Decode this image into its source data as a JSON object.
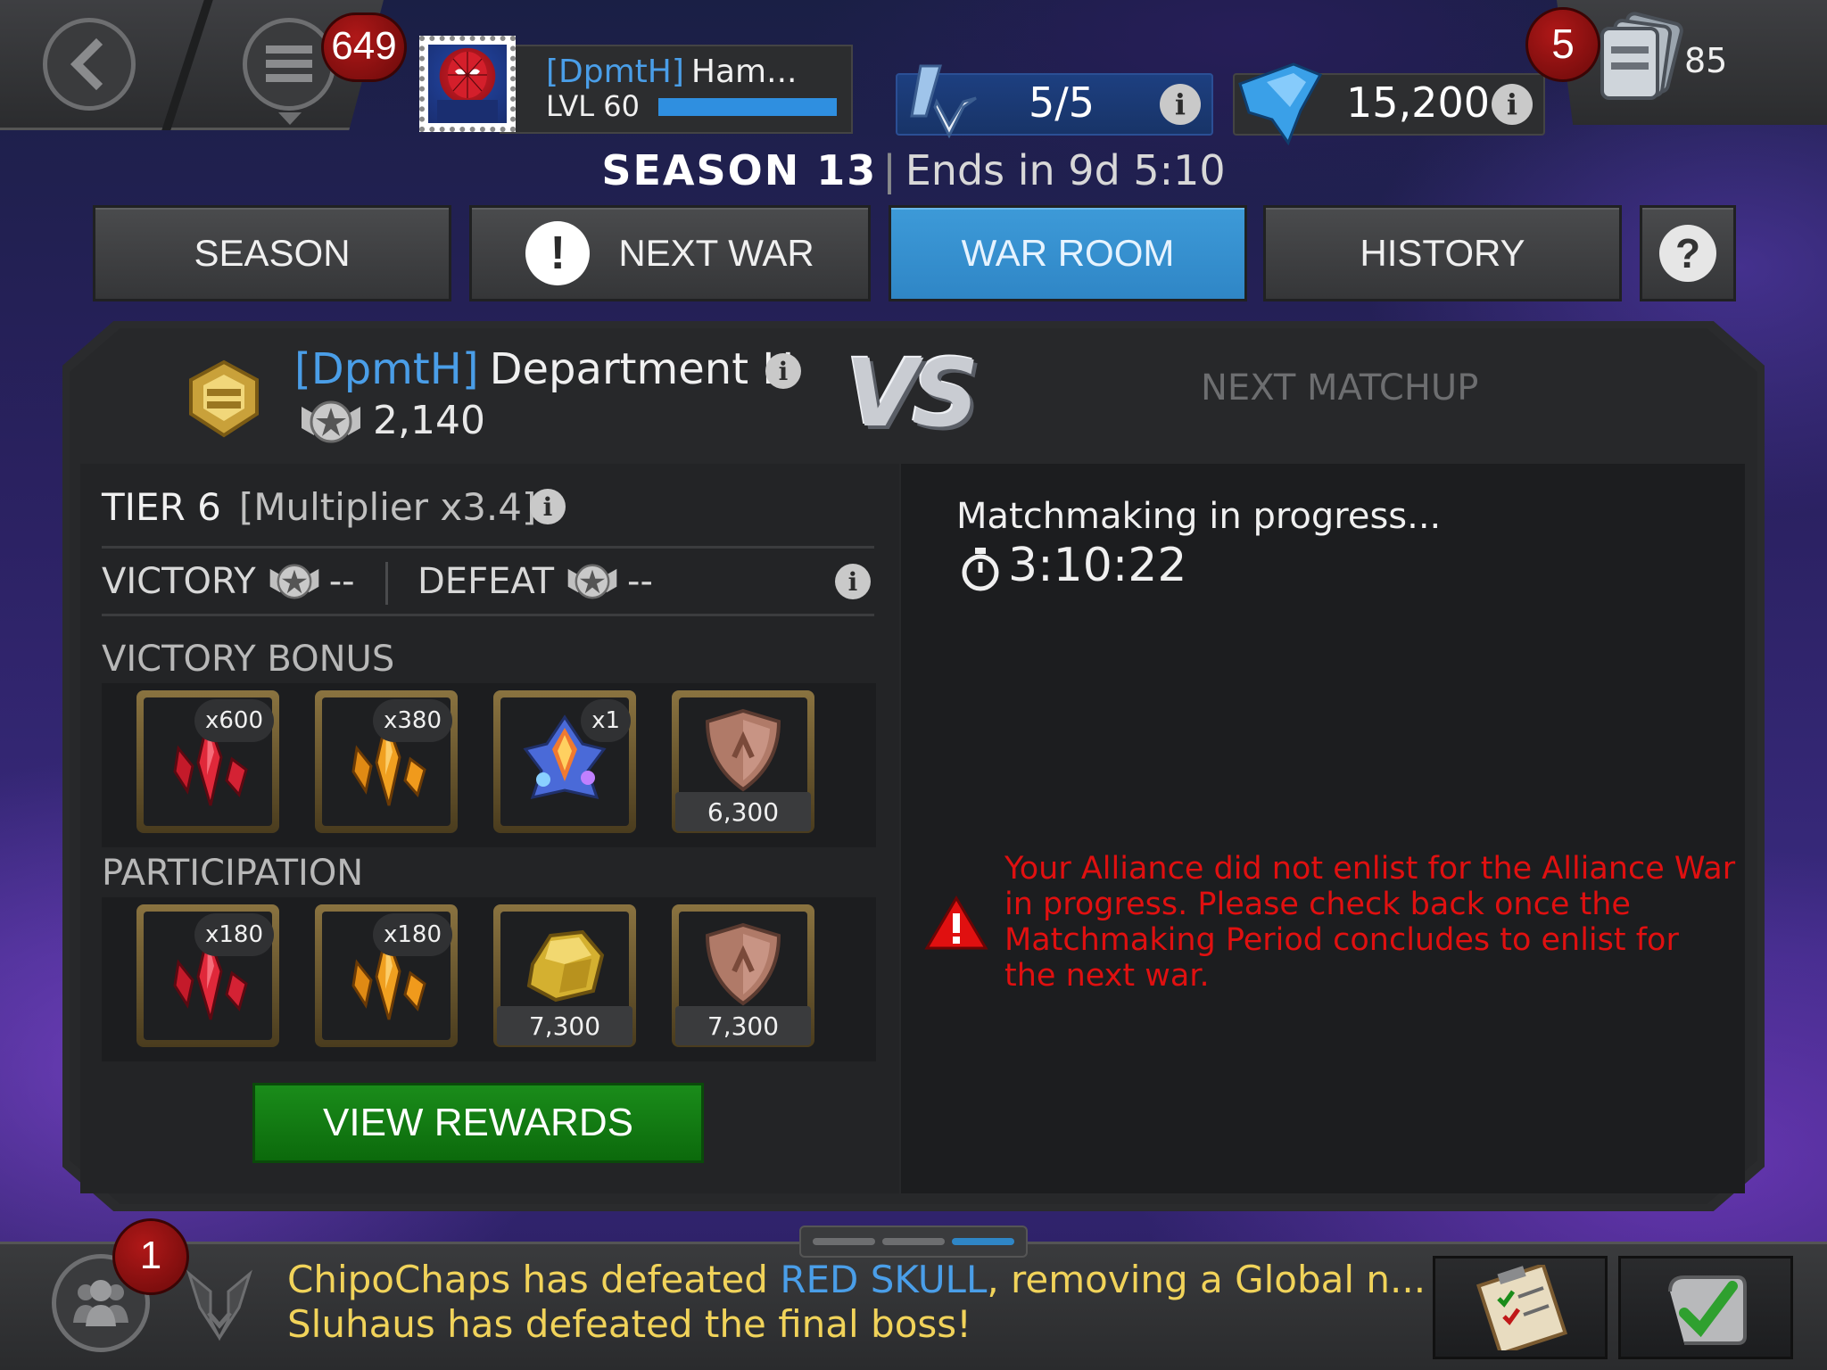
{
  "header": {
    "menu_badge": "649",
    "profile": {
      "alliance_tag": "[DpmtH]",
      "name": "Ham...",
      "level": "LVL 60",
      "xp_progress": 1.0
    },
    "energy": {
      "value": "5/5"
    },
    "crystals": {
      "value": "15,200"
    },
    "mail": {
      "badge": "5",
      "count": "85"
    }
  },
  "season": {
    "title": "SEASON 13",
    "separator": "|",
    "ends": "Ends in 9d 5:10"
  },
  "tabs": [
    {
      "label": "SEASON",
      "active": false
    },
    {
      "label": "NEXT WAR",
      "active": false,
      "alert_glyph": "!"
    },
    {
      "label": "WAR ROOM",
      "active": true
    },
    {
      "label": "HISTORY",
      "active": false
    }
  ],
  "help_glyph": "?",
  "alliance": {
    "tag": "[DpmtH]",
    "name": "Department H",
    "rating": "2,140",
    "vs_text": "VS",
    "opponent": "NEXT MATCHUP"
  },
  "tier": {
    "label": "TIER 6",
    "multiplier": "[Multiplier x3.4]",
    "victory_label": "VICTORY",
    "victory_value": "--",
    "defeat_label": "DEFEAT",
    "defeat_value": "--"
  },
  "victory_bonus": {
    "heading": "VICTORY BONUS",
    "items": [
      {
        "icon": "red-crystal-shards-icon",
        "qty": "x600"
      },
      {
        "icon": "gold-crystal-shards-icon",
        "qty": "x380"
      },
      {
        "icon": "rainbow-crystal-icon",
        "qty": "x1"
      },
      {
        "icon": "bronze-shield-icon",
        "value": "6,300"
      }
    ]
  },
  "participation": {
    "heading": "PARTICIPATION",
    "items": [
      {
        "icon": "red-crystal-shards-icon",
        "qty": "x180"
      },
      {
        "icon": "gold-crystal-shards-icon",
        "qty": "x180"
      },
      {
        "icon": "gold-nugget-icon",
        "value": "7,300"
      },
      {
        "icon": "bronze-shield-icon",
        "value": "7,300"
      }
    ]
  },
  "view_rewards_label": "VIEW REWARDS",
  "matchmaking": {
    "status": "Matchmaking in progress...",
    "timer": "3:10:22",
    "warning": "Your Alliance did not enlist for the Alliance War in progress. Please check back once the Matchmaking Period concludes to enlist for the next war."
  },
  "bottom": {
    "alliance_badge": "1",
    "ticker_line1_a": "ChipoChaps has defeated ",
    "ticker_line1_hl": "RED SKULL",
    "ticker_line1_b": ", removing a Global n...",
    "ticker_line2": "Sluhaus has defeated the final boss!"
  },
  "colors": {
    "accent_blue": "#2f86c6",
    "warning_red": "#e01010",
    "ticker_yellow": "#f1d35a",
    "alliance_tag_blue": "#4a9ee8",
    "button_green": "#0c6a0c"
  }
}
